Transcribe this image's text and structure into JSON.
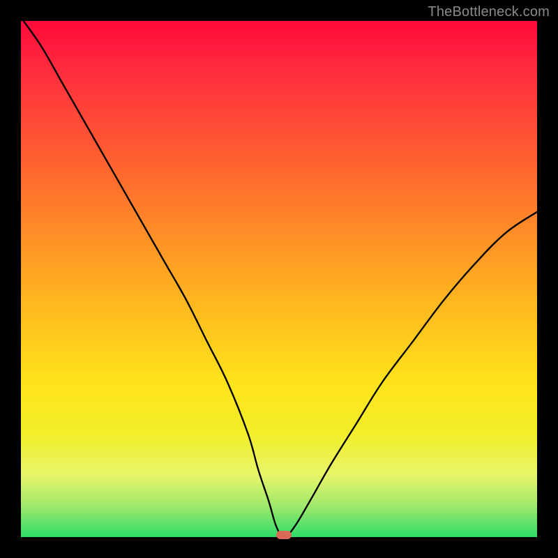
{
  "watermark": "TheBottleneck.com",
  "accent_colors": {
    "top": "#ff0a3a",
    "mid": "#ffd21a",
    "bottom": "#2ddc69",
    "curve": "#000000",
    "marker": "#d96a57",
    "frame": "#000000"
  },
  "chart_data": {
    "type": "line",
    "title": "",
    "xlabel": "",
    "ylabel": "",
    "xlim": [
      0,
      100
    ],
    "ylim": [
      0,
      100
    ],
    "series": [
      {
        "name": "bottleneck-curve",
        "x": [
          0.5,
          4,
          8,
          12,
          16,
          20,
          24,
          28,
          32,
          36,
          40,
          44,
          46,
          48,
          49.5,
          51,
          53,
          56,
          60,
          65,
          70,
          76,
          82,
          88,
          94,
          100
        ],
        "y": [
          100,
          95,
          88,
          81,
          74,
          67,
          60,
          53,
          46,
          38,
          30,
          20,
          13,
          7,
          2,
          0,
          2,
          7,
          14,
          22,
          30,
          38,
          46,
          53,
          59,
          63
        ]
      }
    ],
    "marker": {
      "x": 51,
      "y": 0
    }
  }
}
